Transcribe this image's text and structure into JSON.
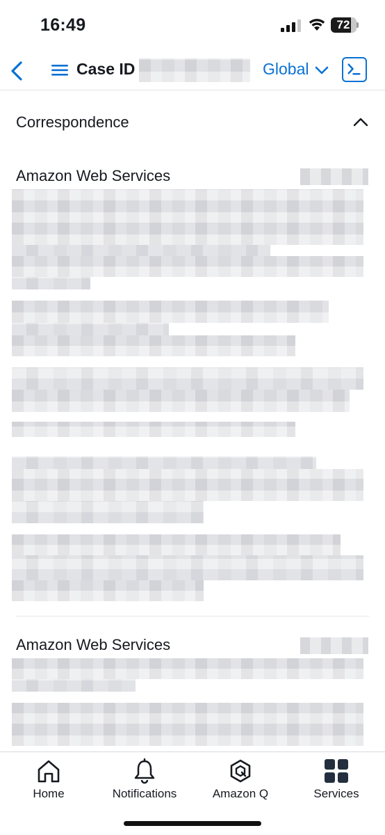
{
  "status_bar": {
    "time": "16:49",
    "battery": "72"
  },
  "nav": {
    "title": "Case ID",
    "region": "Global"
  },
  "section": {
    "title": "Correspondence"
  },
  "messages": [
    {
      "sender": "Amazon Web Services"
    },
    {
      "sender": "Amazon Web Services"
    }
  ],
  "tabs": [
    {
      "label": "Home",
      "icon": "home-icon"
    },
    {
      "label": "Notifications",
      "icon": "bell-icon"
    },
    {
      "label": "Amazon Q",
      "icon": "amazon-q-icon"
    },
    {
      "label": "Services",
      "icon": "grid-icon"
    }
  ],
  "colors": {
    "accent": "#0972d3",
    "text": "#16191f",
    "divider": "#e5e7ea"
  }
}
